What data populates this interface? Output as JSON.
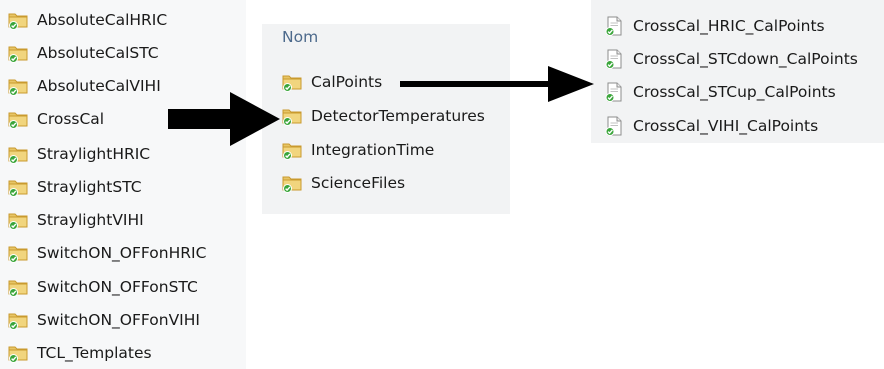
{
  "left_list": {
    "items": [
      {
        "label": "AbsoluteCalHRIC"
      },
      {
        "label": "AbsoluteCalSTC"
      },
      {
        "label": "AbsoluteCalVIHI"
      },
      {
        "label": "CrossCal"
      },
      {
        "label": "StraylightHRIC"
      },
      {
        "label": "StraylightSTC"
      },
      {
        "label": "StraylightVIHI"
      },
      {
        "label": "SwitchON_OFFonHRIC"
      },
      {
        "label": "SwitchON_OFFonSTC"
      },
      {
        "label": "SwitchON_OFFonVIHI"
      },
      {
        "label": "TCL_Templates"
      }
    ]
  },
  "middle_list": {
    "header": "Nom",
    "items": [
      {
        "label": "CalPoints"
      },
      {
        "label": "DetectorTemperatures"
      },
      {
        "label": "IntegrationTime"
      },
      {
        "label": "ScienceFiles"
      }
    ]
  },
  "right_list": {
    "items": [
      {
        "label": "CrossCal_HRIC_CalPoints"
      },
      {
        "label": "CrossCal_STCdown_CalPoints"
      },
      {
        "label": "CrossCal_STCup_CalPoints"
      },
      {
        "label": "CrossCal_VIHI_CalPoints"
      }
    ]
  },
  "colors": {
    "folder_fill": "#e7c566",
    "folder_dark": "#c99a2e",
    "check_green": "#3aa53a",
    "arrow": "#000000"
  }
}
